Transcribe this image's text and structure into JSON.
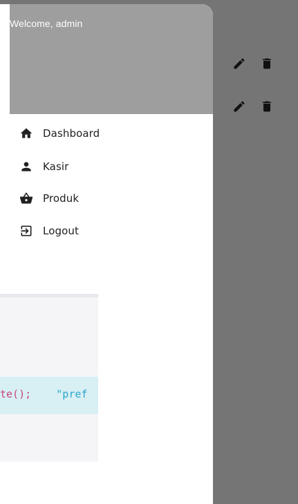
{
  "drawer": {
    "welcome_text": "Welcome, admin",
    "header_color": "#9e9e9e",
    "menu": [
      {
        "icon": "home-icon",
        "label": "Dashboard"
      },
      {
        "icon": "person-icon",
        "label": "Kasir"
      },
      {
        "icon": "basket-icon",
        "label": "Produk"
      },
      {
        "icon": "logout-icon",
        "label": "Logout"
      }
    ]
  },
  "background": {
    "rows": [
      {
        "actions": [
          "edit-icon",
          "delete-icon"
        ]
      },
      {
        "actions": [
          "edit-icon",
          "delete-icon"
        ]
      }
    ]
  },
  "code_preview": {
    "fragment_call": "te();",
    "fragment_string": "\"pref"
  }
}
